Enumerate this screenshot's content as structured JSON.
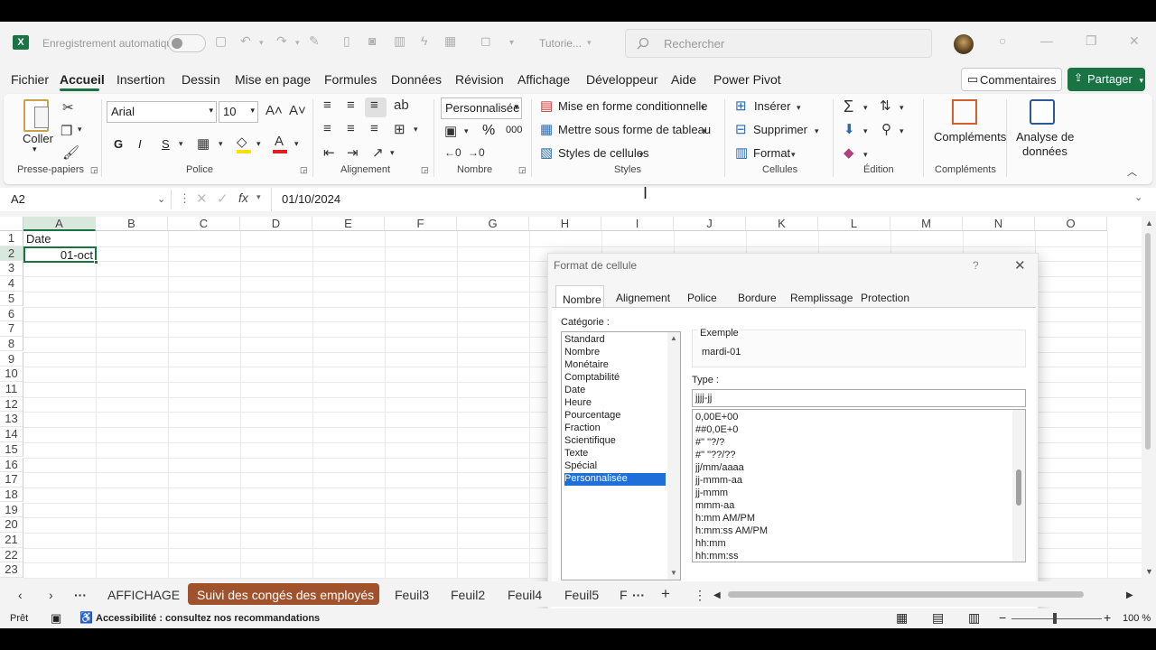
{
  "titlebar": {
    "autosave_label": "Enregistrement automatique",
    "filename": "Tutorie...",
    "search_placeholder": "Rechercher"
  },
  "menu": {
    "items": [
      "Fichier",
      "Accueil",
      "Insertion",
      "Dessin",
      "Mise en page",
      "Formules",
      "Données",
      "Révision",
      "Affichage",
      "Développeur",
      "Aide",
      "Power Pivot"
    ],
    "comments": "Commentaires",
    "share": "Partager"
  },
  "ribbon": {
    "clipboard": {
      "paste": "Coller",
      "label": "Presse-papiers"
    },
    "font": {
      "name": "Arial",
      "size": "10",
      "bold": "G",
      "italic": "I",
      "underline": "S",
      "label": "Police"
    },
    "alignment": {
      "label": "Alignement"
    },
    "number": {
      "format": "Personnalisée",
      "percent": "%",
      "thousands": "000",
      "label": "Nombre"
    },
    "styles": {
      "conditional": "Mise en forme conditionnelle",
      "table": "Mettre sous forme de tableau",
      "cell_styles": "Styles de cellules",
      "label": "Styles"
    },
    "cells": {
      "insert": "Insérer",
      "delete": "Supprimer",
      "format": "Format",
      "label": "Cellules"
    },
    "editing": {
      "label": "Édition"
    },
    "addins": {
      "button": "Compléments",
      "label": "Compléments"
    },
    "analysis": {
      "button_line1": "Analyse de",
      "button_line2": "données"
    }
  },
  "formula_bar": {
    "name_box": "A2",
    "fx": "fx",
    "value": "01/10/2024"
  },
  "grid": {
    "columns": [
      "A",
      "B",
      "C",
      "D",
      "E",
      "F",
      "G",
      "H",
      "I",
      "J",
      "K",
      "L",
      "M",
      "N",
      "O"
    ],
    "rows": [
      "1",
      "2",
      "3",
      "4",
      "5",
      "6",
      "7",
      "8",
      "9",
      "10",
      "11",
      "12",
      "13",
      "14",
      "15",
      "16",
      "17",
      "18",
      "19",
      "20",
      "21",
      "22",
      "23"
    ],
    "cells": {
      "A1": "Date",
      "A2": "01-oct"
    }
  },
  "dialog": {
    "title": "Format de cellule",
    "help": "?",
    "tabs": [
      "Nombre",
      "Alignement",
      "Police",
      "Bordure",
      "Remplissage",
      "Protection"
    ],
    "category_label": "Catégorie :",
    "categories": [
      "Standard",
      "Nombre",
      "Monétaire",
      "Comptabilité",
      "Date",
      "Heure",
      "Pourcentage",
      "Fraction",
      "Scientifique",
      "Texte",
      "Spécial",
      "Personnalisée"
    ],
    "selected_category": "Personnalisée",
    "example_label": "Exemple",
    "example_value": "mardi-01",
    "type_label": "Type :",
    "type_value": "jjjj-jj",
    "types": [
      "0,00E+00",
      "##0,0E+0",
      "#\" \"?/?",
      "#\" \"??/??",
      "jj/mm/aaaa",
      "jj-mmm-aa",
      "jj-mmm",
      "mmm-aa",
      "h:mm AM/PM",
      "h:mm:ss AM/PM",
      "hh:mm",
      "hh:mm:ss"
    ]
  },
  "sheets": {
    "tabs": [
      "AFFICHAGE",
      "Suivi des congés des employés",
      "Feuil3",
      "Feuil2",
      "Feuil4",
      "Feuil5",
      "F"
    ],
    "active": "Suivi des congés des employés",
    "active_color": "#a0522d"
  },
  "status": {
    "ready": "Prêt",
    "accessibility": "Accessibilité : consultez nos recommandations",
    "zoom": "100 %"
  },
  "colors": {
    "excel_green": "#1a7343",
    "selection": "#1e6fd9"
  }
}
